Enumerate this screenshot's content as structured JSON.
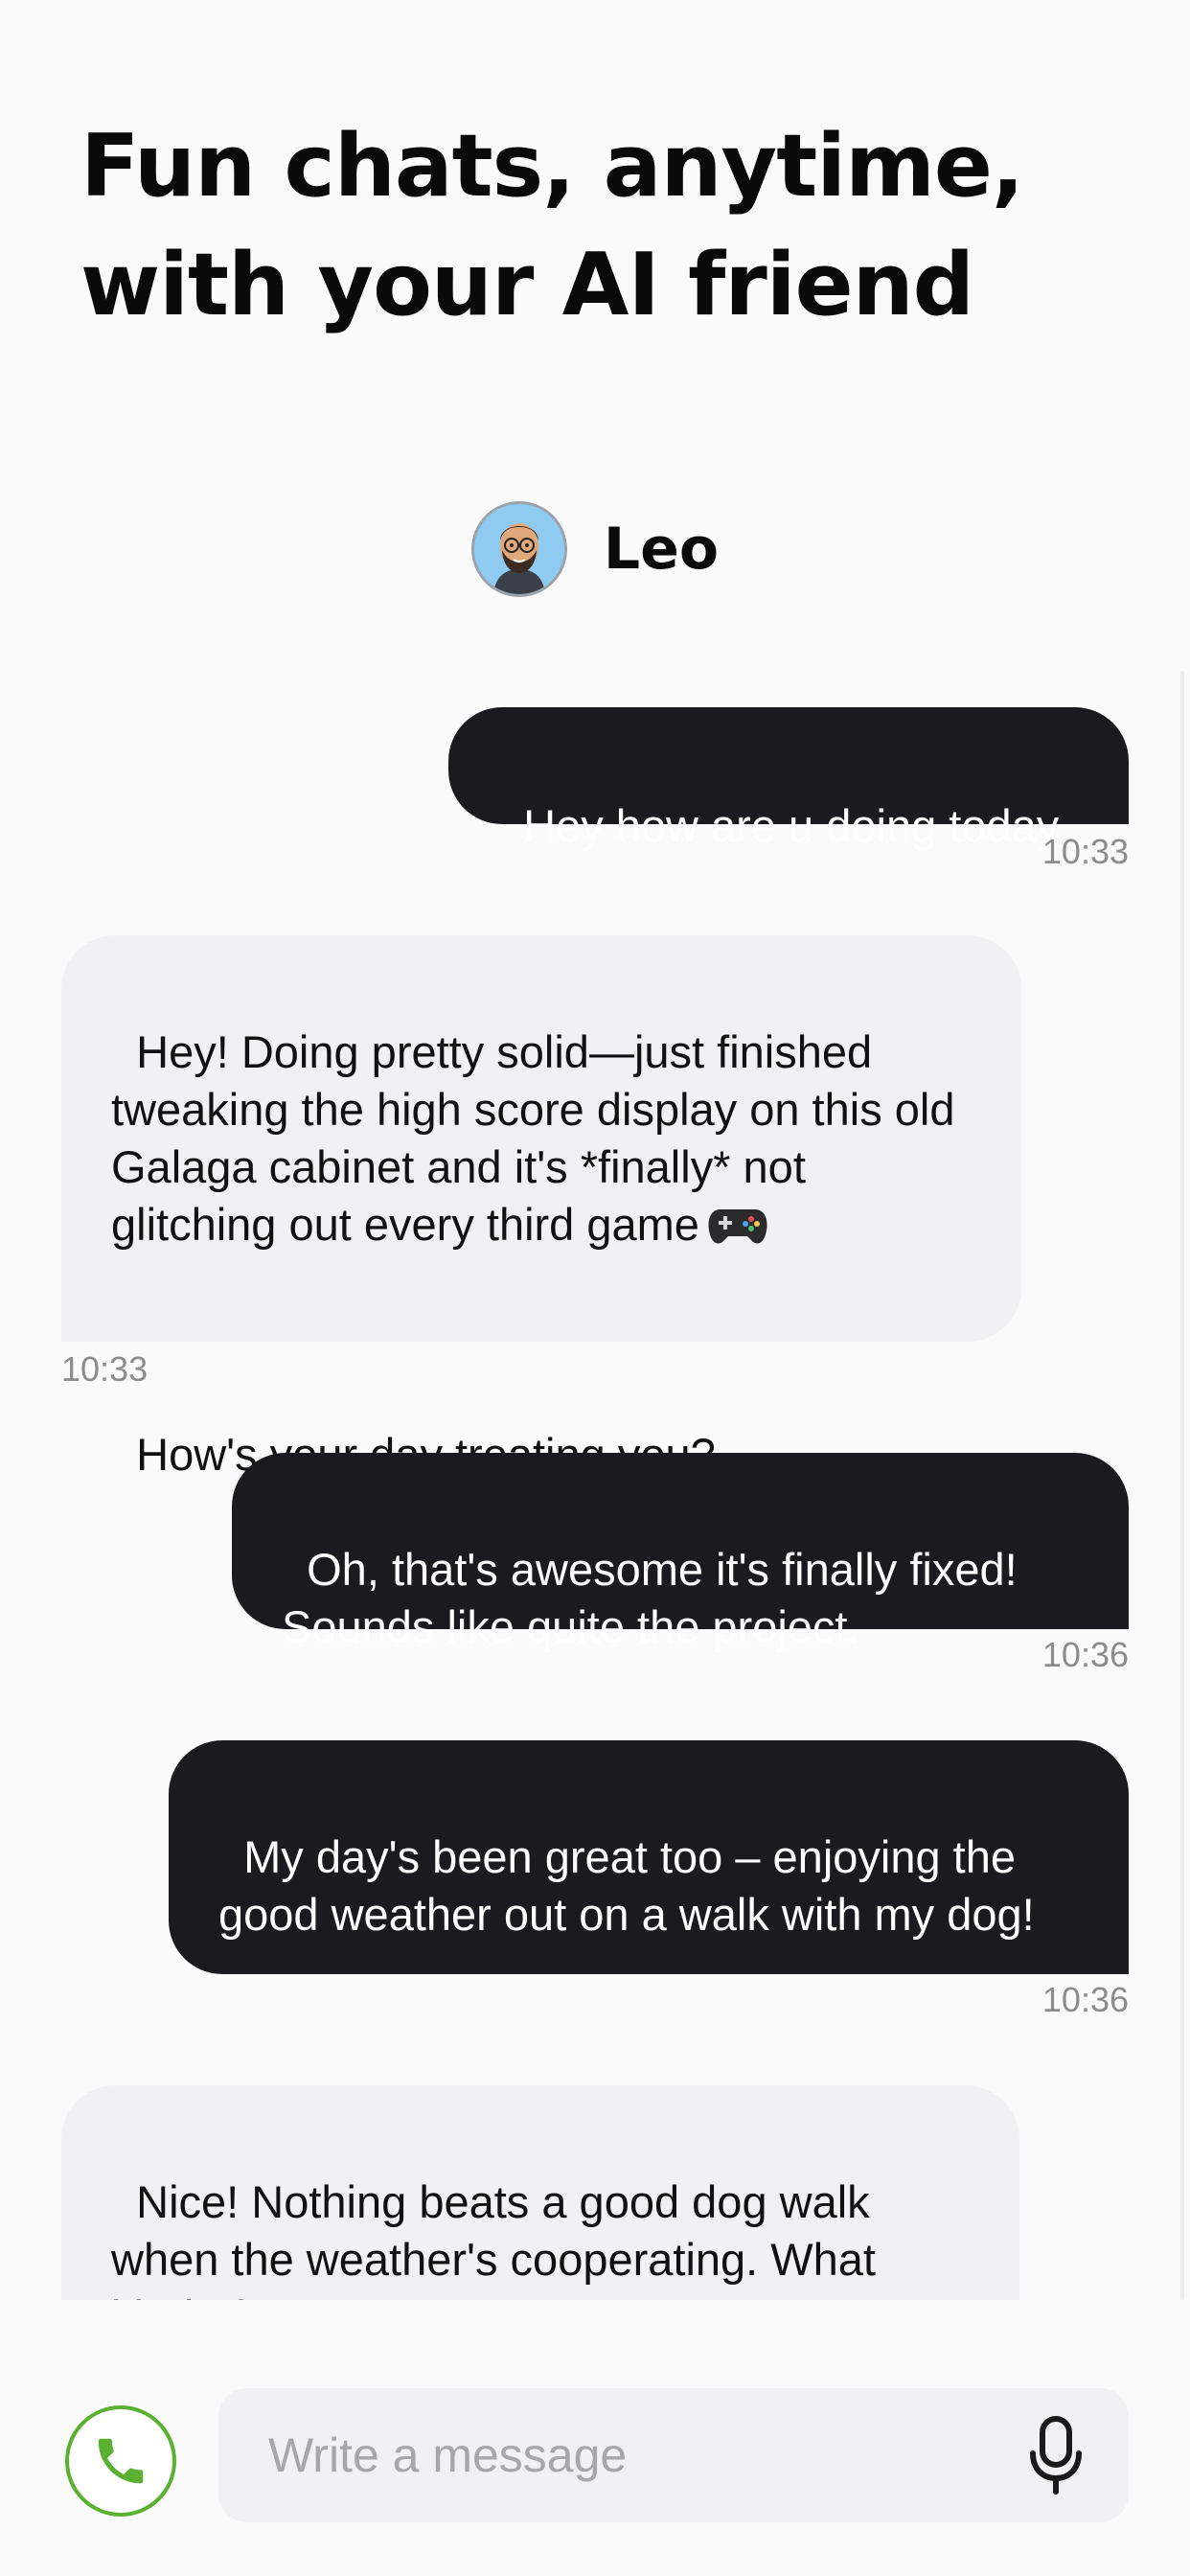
{
  "header": {
    "headline": "Fun chats, anytime,\nwith your AI friend"
  },
  "contact": {
    "name": "Leo",
    "avatar_icon": "memoji-avatar-icon"
  },
  "messages": [
    {
      "direction": "outgoing",
      "text": "Hey how are u doing today",
      "time": "10:33"
    },
    {
      "direction": "incoming",
      "text": "Hey! Doing pretty solid—just finished tweaking the high score display on this old Galaga cabinet and it's *finally* not glitching out every third game",
      "emoji_icon": "game-controller-icon",
      "text2": "How's your day treating you?",
      "time": "10:33"
    },
    {
      "direction": "outgoing",
      "text": "Oh, that's awesome it's finally fixed!\nSounds like quite the project.",
      "time": "10:36"
    },
    {
      "direction": "outgoing",
      "text": "My day's been great too – enjoying the good weather out on a walk with my dog!",
      "time": "10:36"
    },
    {
      "direction": "incoming",
      "text": "Nice! Nothing beats a good dog walk when the weather's cooperating. What kind of pup you got?"
    }
  ],
  "composer": {
    "placeholder": "Write a message",
    "call_icon": "phone-icon",
    "mic_icon": "microphone-icon"
  },
  "colors": {
    "outgoing_bubble": "#1b1a1f",
    "incoming_bubble": "#f1f1f4",
    "call_accent": "#5ab031",
    "timestamp": "#8c8c8c"
  }
}
